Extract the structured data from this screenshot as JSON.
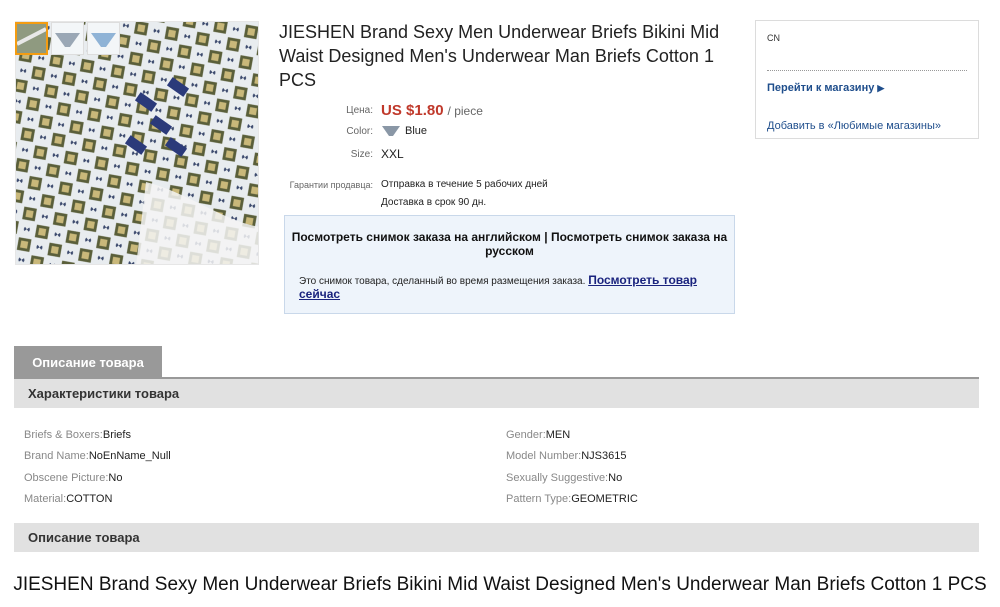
{
  "product": {
    "title": "JIESHEN Brand Sexy Men Underwear Briefs Bikini Mid Waist Designed Men's Underwear Man Briefs Cotton 1 PCS",
    "price_label": "Цена:",
    "price_value": "US $1.80",
    "price_unit": "/ piece",
    "color_label": "Color:",
    "color_value": "Blue",
    "size_label": "Size:",
    "size_value": "XXL",
    "guarantee_label": "Гарантии продавца:",
    "guarantee_line1": "Отправка в течение 5 рабочих дней",
    "guarantee_line2": "Доставка в срок 90 дн."
  },
  "snapshot": {
    "link_en": "Посмотреть снимок заказа на английском",
    "separator": "|",
    "link_ru": "Посмотреть снимок заказа на русском",
    "note": "Это снимок товара, сделанный во время размещения заказа.",
    "view_now": "Посмотреть товар сейчас"
  },
  "store": {
    "country": "CN",
    "go_to_store": "Перейти к магазину",
    "add_favorite": "Добавить в «Любимые магазины»"
  },
  "tabs": {
    "description": "Описание товара"
  },
  "specs": {
    "heading": "Характеристики товара",
    "items": [
      {
        "key": "Briefs & Boxers:",
        "value": "Briefs"
      },
      {
        "key": "Gender:",
        "value": "MEN"
      },
      {
        "key": "Brand Name:",
        "value": "NoEnName_Null"
      },
      {
        "key": "Model Number:",
        "value": "NJS3615"
      },
      {
        "key": "Obscene Picture:",
        "value": "No"
      },
      {
        "key": "Sexually Suggestive:",
        "value": "No"
      },
      {
        "key": "Material:",
        "value": "COTTON"
      },
      {
        "key": "Pattern Type:",
        "value": "GEOMETRIC"
      }
    ]
  },
  "description": {
    "heading": "Описание товара",
    "title_line": "JIESHEN Brand Sexy Men Underwear Briefs Bikini Mid Waist Designed Men's Underwear  Man Briefs Cotton 1 PCS"
  },
  "colors": {
    "price": "#c0392b",
    "link": "#1f4e8c",
    "tab": "#999999",
    "section_bar": "#e1e1e1",
    "snapshot_bg": "#eef4fb"
  }
}
